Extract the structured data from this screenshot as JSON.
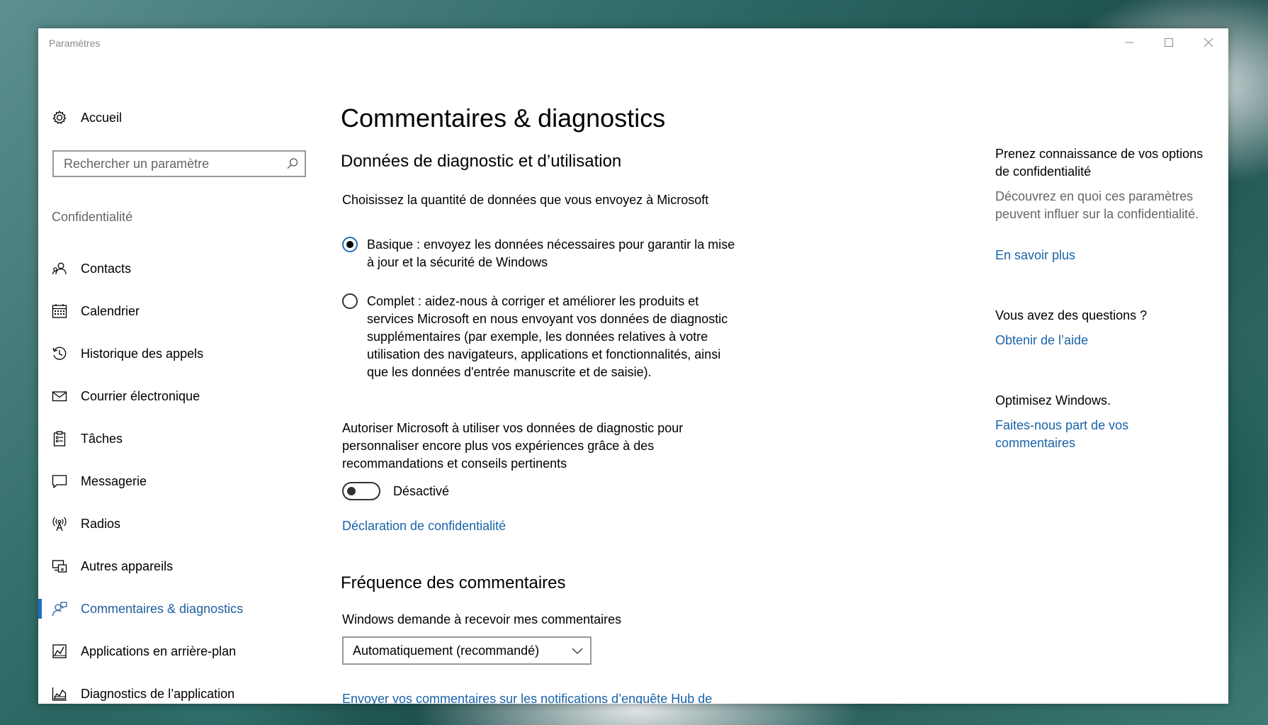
{
  "window": {
    "title": "Paramètres"
  },
  "sidebar": {
    "home_label": "Accueil",
    "search_placeholder": "Rechercher un paramètre",
    "section_label": "Confidentialité",
    "items": [
      {
        "label": "Contacts",
        "icon": "contacts-icon"
      },
      {
        "label": "Calendrier",
        "icon": "calendar-icon"
      },
      {
        "label": "Historique des appels",
        "icon": "history-icon"
      },
      {
        "label": "Courrier électronique",
        "icon": "mail-icon"
      },
      {
        "label": "Tâches",
        "icon": "tasks-icon"
      },
      {
        "label": "Messagerie",
        "icon": "chat-icon"
      },
      {
        "label": "Radios",
        "icon": "radio-tower-icon"
      },
      {
        "label": "Autres appareils",
        "icon": "devices-icon"
      },
      {
        "label": "Commentaires & diagnostics",
        "icon": "feedback-icon",
        "active": true
      },
      {
        "label": "Applications en arrière-plan",
        "icon": "background-apps-icon"
      },
      {
        "label": "Diagnostics de l’application",
        "icon": "app-diagnostics-icon"
      }
    ]
  },
  "main": {
    "title": "Commentaires & diagnostics",
    "diag_heading": "Données de diagnostic et d’utilisation",
    "diag_intro": "Choisissez la quantité de données que vous envoyez à Microsoft",
    "options": [
      {
        "label": "Basique : envoyez les données nécessaires pour garantir la mise à jour et la sécurité de Windows",
        "checked": true
      },
      {
        "label": "Complet : aidez-nous à corriger et améliorer les produits et services Microsoft en nous envoyant vos données de diagnostic supplémentaires (par exemple, les données relatives à votre utilisation des navigateurs, applications et fonctionnalités, ainsi que les données d'entrée manuscrite et de saisie).",
        "checked": false
      }
    ],
    "tailored_text": "Autoriser Microsoft à utiliser vos données de diagnostic pour personnaliser encore plus vos expériences grâce à des recommandations et conseils pertinents",
    "toggle_label": "Désactivé",
    "privacy_link": "Déclaration de confidentialité",
    "freq_heading": "Fréquence des commentaires",
    "freq_label": "Windows demande à recevoir mes commentaires",
    "freq_value": "Automatiquement (recommandé)",
    "hub_link": "Envoyer vos commentaires sur les notifications d’enquête Hub de commentaires"
  },
  "aside": {
    "privacy_heading": "Prenez connaissance de vos options de confidentialité",
    "privacy_text": "Découvrez en quoi ces paramètres peuvent influer sur la confidentialité.",
    "learn_more": "En savoir plus",
    "questions_heading": "Vous avez des questions ?",
    "get_help": "Obtenir de l’aide",
    "improve_heading": "Optimisez Windows.",
    "feedback_link": "Faites-nous part de vos commentaires"
  },
  "colors": {
    "accent": "#1e6fbf",
    "link": "#1a63a8"
  }
}
